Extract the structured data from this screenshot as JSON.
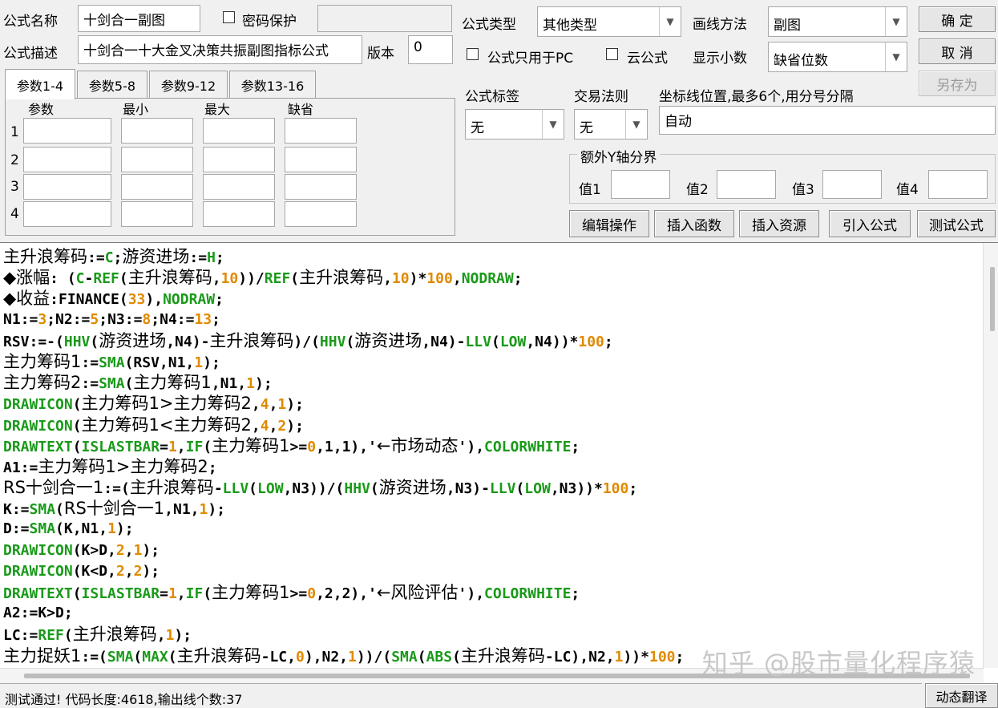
{
  "form": {
    "name_label": "公式名称",
    "name_value": "十剑合一副图",
    "password_label": "密码保护",
    "password_value": "",
    "desc_label": "公式描述",
    "desc_value": "十剑合一十大金叉决策共振副图指标公式",
    "version_label": "版本",
    "version_value": "0",
    "type_label": "公式类型",
    "type_value": "其他类型",
    "draw_label": "画线方法",
    "draw_value": "副图",
    "pc_only_label": "公式只用于PC",
    "cloud_label": "云公式",
    "decimals_label": "显示小数",
    "decimals_value": "缺省位数",
    "tag_label": "公式标签",
    "tag_value": "无",
    "trade_label": "交易法则",
    "trade_value": "无",
    "coord_label": "坐标线位置,最多6个,用分号分隔",
    "coord_value": "自动",
    "yaxis_group_label": "额外Y轴分界",
    "yaxis_labels": [
      "值1",
      "值2",
      "值3",
      "值4"
    ]
  },
  "buttons": {
    "ok": "确 定",
    "cancel": "取 消",
    "save_as": "另存为",
    "edit_ops": "编辑操作",
    "insert_func": "插入函数",
    "insert_res": "插入资源",
    "import_formula": "引入公式",
    "test_formula": "测试公式",
    "dyn_translate": "动态翻译"
  },
  "tabs": [
    "参数1-4",
    "参数5-8",
    "参数9-12",
    "参数13-16"
  ],
  "params": {
    "headers": [
      "参数",
      "最小",
      "最大",
      "缺省"
    ],
    "rows": [
      "1",
      "2",
      "3",
      "4"
    ]
  },
  "code_lines": [
    [
      [
        "主升浪筹码",
        ""
      ],
      [
        ":=",
        ""
      ],
      [
        "C",
        "fn"
      ],
      [
        ";",
        ""
      ],
      [
        "游资进场",
        ""
      ],
      [
        ":=",
        ""
      ],
      [
        "H",
        "fn"
      ],
      [
        ";",
        ""
      ]
    ],
    [
      [
        "◆涨幅",
        ""
      ],
      [
        ": (",
        ""
      ],
      [
        "C",
        "fn"
      ],
      [
        "-",
        ""
      ],
      [
        "REF",
        "fn"
      ],
      [
        "(",
        ""
      ],
      [
        "主升浪筹码",
        ""
      ],
      [
        ",",
        ""
      ],
      [
        "10",
        "num"
      ],
      [
        "))/",
        ""
      ],
      [
        "REF",
        "fn"
      ],
      [
        "(",
        ""
      ],
      [
        "主升浪筹码",
        ""
      ],
      [
        ",",
        ""
      ],
      [
        "10",
        "num"
      ],
      [
        ")*",
        ""
      ],
      [
        "100",
        "num"
      ],
      [
        ",",
        ""
      ],
      [
        "NODRAW",
        "fn"
      ],
      [
        ";",
        ""
      ]
    ],
    [
      [
        "◆收益",
        ""
      ],
      [
        ":FINANCE(",
        ""
      ],
      [
        "33",
        "num"
      ],
      [
        "),",
        ""
      ],
      [
        "NODRAW",
        "fn"
      ],
      [
        ";",
        ""
      ]
    ],
    [
      [
        "N1:=",
        ""
      ],
      [
        "3",
        "num"
      ],
      [
        ";N2:=",
        ""
      ],
      [
        "5",
        "num"
      ],
      [
        ";N3:=",
        ""
      ],
      [
        "8",
        "num"
      ],
      [
        ";N4:=",
        ""
      ],
      [
        "13",
        "num"
      ],
      [
        ";",
        ""
      ]
    ],
    [
      [
        "RSV:=-(",
        ""
      ],
      [
        "HHV",
        "fn"
      ],
      [
        "(",
        ""
      ],
      [
        "游资进场",
        ""
      ],
      [
        ",N4)-",
        ""
      ],
      [
        "主升浪筹码",
        ""
      ],
      [
        ")/(",
        ""
      ],
      [
        "HHV",
        "fn"
      ],
      [
        "(",
        ""
      ],
      [
        "游资进场",
        ""
      ],
      [
        ",N4)-",
        ""
      ],
      [
        "LLV",
        "fn"
      ],
      [
        "(",
        ""
      ],
      [
        "LOW",
        "fn"
      ],
      [
        ",N4))*",
        ""
      ],
      [
        "100",
        "num"
      ],
      [
        ";",
        ""
      ]
    ],
    [
      [
        "主力筹码1",
        ""
      ],
      [
        ":=",
        ""
      ],
      [
        "SMA",
        "fn"
      ],
      [
        "(RSV,N1,",
        ""
      ],
      [
        "1",
        "num"
      ],
      [
        ");",
        ""
      ]
    ],
    [
      [
        "主力筹码2",
        ""
      ],
      [
        ":=",
        ""
      ],
      [
        "SMA",
        "fn"
      ],
      [
        "(",
        ""
      ],
      [
        "主力筹码1",
        ""
      ],
      [
        ",N1,",
        ""
      ],
      [
        "1",
        "num"
      ],
      [
        ");",
        ""
      ]
    ],
    [
      [
        "DRAWICON",
        "fn"
      ],
      [
        "(",
        ""
      ],
      [
        "主力筹码1>主力筹码2",
        ""
      ],
      [
        ",",
        ""
      ],
      [
        "4",
        "num"
      ],
      [
        ",",
        ""
      ],
      [
        "1",
        "num"
      ],
      [
        ");",
        ""
      ]
    ],
    [
      [
        "DRAWICON",
        "fn"
      ],
      [
        "(",
        ""
      ],
      [
        "主力筹码1<主力筹码2",
        ""
      ],
      [
        ",",
        ""
      ],
      [
        "4",
        "num"
      ],
      [
        ",",
        ""
      ],
      [
        "2",
        "num"
      ],
      [
        ");",
        ""
      ]
    ],
    [
      [
        "DRAWTEXT",
        "fn"
      ],
      [
        "(",
        ""
      ],
      [
        "ISLASTBAR",
        "fn"
      ],
      [
        "=",
        ""
      ],
      [
        "1",
        "num"
      ],
      [
        ",",
        ""
      ],
      [
        "IF",
        "fn"
      ],
      [
        "(",
        ""
      ],
      [
        "主力筹码1",
        ""
      ],
      [
        ">=",
        ""
      ],
      [
        "0",
        "num"
      ],
      [
        ",1,1),'",
        ""
      ],
      [
        "←市场动态",
        ""
      ],
      [
        "'),",
        ""
      ],
      [
        "COLORWHITE",
        "fn"
      ],
      [
        ";",
        ""
      ]
    ],
    [
      [
        "A1:=",
        ""
      ],
      [
        "主力筹码1>主力筹码2",
        ""
      ],
      [
        ";",
        ""
      ]
    ],
    [
      [
        "RS十剑合一1",
        ""
      ],
      [
        ":=(",
        ""
      ],
      [
        "主升浪筹码",
        ""
      ],
      [
        "-",
        ""
      ],
      [
        "LLV",
        "fn"
      ],
      [
        "(",
        ""
      ],
      [
        "LOW",
        "fn"
      ],
      [
        ",N3))/(",
        ""
      ],
      [
        "HHV",
        "fn"
      ],
      [
        "(",
        ""
      ],
      [
        "游资进场",
        ""
      ],
      [
        ",N3)-",
        ""
      ],
      [
        "LLV",
        "fn"
      ],
      [
        "(",
        ""
      ],
      [
        "LOW",
        "fn"
      ],
      [
        ",N3))*",
        ""
      ],
      [
        "100",
        "num"
      ],
      [
        ";",
        ""
      ]
    ],
    [
      [
        "K:=",
        ""
      ],
      [
        "SMA",
        "fn"
      ],
      [
        "(",
        ""
      ],
      [
        "RS十剑合一1",
        ""
      ],
      [
        ",N1,",
        ""
      ],
      [
        "1",
        "num"
      ],
      [
        ");",
        ""
      ]
    ],
    [
      [
        "D:=",
        ""
      ],
      [
        "SMA",
        "fn"
      ],
      [
        "(K,N1,",
        ""
      ],
      [
        "1",
        "num"
      ],
      [
        ");",
        ""
      ]
    ],
    [
      [
        "DRAWICON",
        "fn"
      ],
      [
        "(K>D,",
        ""
      ],
      [
        "2",
        "num"
      ],
      [
        ",",
        ""
      ],
      [
        "1",
        "num"
      ],
      [
        ");",
        ""
      ]
    ],
    [
      [
        "DRAWICON",
        "fn"
      ],
      [
        "(K<D,",
        ""
      ],
      [
        "2",
        "num"
      ],
      [
        ",",
        ""
      ],
      [
        "2",
        "num"
      ],
      [
        ");",
        ""
      ]
    ],
    [
      [
        "DRAWTEXT",
        "fn"
      ],
      [
        "(",
        ""
      ],
      [
        "ISLASTBAR",
        "fn"
      ],
      [
        "=",
        ""
      ],
      [
        "1",
        "num"
      ],
      [
        ",",
        ""
      ],
      [
        "IF",
        "fn"
      ],
      [
        "(",
        ""
      ],
      [
        "主力筹码1",
        ""
      ],
      [
        ">=",
        ""
      ],
      [
        "0",
        "num"
      ],
      [
        ",2,2),'",
        ""
      ],
      [
        "←风险评估",
        ""
      ],
      [
        "'),",
        ""
      ],
      [
        "COLORWHITE",
        "fn"
      ],
      [
        ";",
        ""
      ]
    ],
    [
      [
        "A2:=K>D;",
        ""
      ]
    ],
    [
      [
        "LC:=",
        ""
      ],
      [
        "REF",
        "fn"
      ],
      [
        "(",
        ""
      ],
      [
        "主升浪筹码",
        ""
      ],
      [
        ",",
        ""
      ],
      [
        "1",
        "num"
      ],
      [
        ");",
        ""
      ]
    ],
    [
      [
        "主力捉妖1",
        ""
      ],
      [
        ":=(",
        ""
      ],
      [
        "SMA",
        "fn"
      ],
      [
        "(",
        ""
      ],
      [
        "MAX",
        "fn"
      ],
      [
        "(",
        ""
      ],
      [
        "主升浪筹码",
        ""
      ],
      [
        "-LC,",
        ""
      ],
      [
        "0",
        "num"
      ],
      [
        "),N2,",
        ""
      ],
      [
        "1",
        "num"
      ],
      [
        "))/(",
        ""
      ],
      [
        "SMA",
        "fn"
      ],
      [
        "(",
        ""
      ],
      [
        "ABS",
        "fn"
      ],
      [
        "(",
        ""
      ],
      [
        "主升浪筹码",
        ""
      ],
      [
        "-LC),N2,",
        ""
      ],
      [
        "1",
        "num"
      ],
      [
        "))*",
        ""
      ],
      [
        "100",
        "num"
      ],
      [
        ";",
        ""
      ]
    ]
  ],
  "status": "测试通过! 代码长度:4618,输出线个数:37",
  "watermark": "知乎 @股市量化程序猿",
  "colors": {
    "function": "#1a9a1a",
    "number": "#e08a00"
  }
}
